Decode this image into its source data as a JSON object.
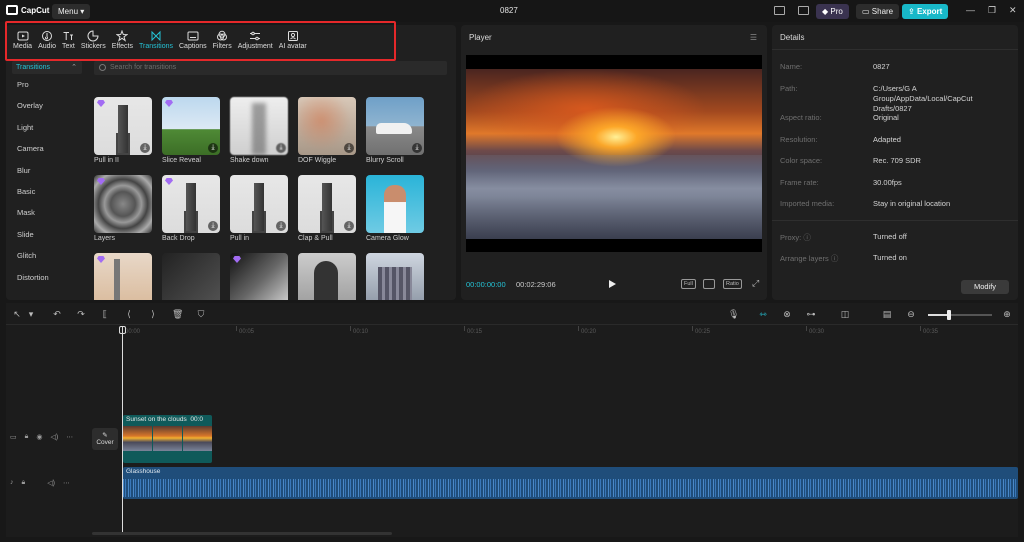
{
  "app": {
    "logo_text": "CapCut",
    "menu_label": "Menu",
    "project_title": "0827",
    "pro_label": "Pro",
    "share_label": "Share",
    "export_label": "Export"
  },
  "toolbar": {
    "items": [
      {
        "label": "Media",
        "icon": "media-icon"
      },
      {
        "label": "Audio",
        "icon": "audio-icon"
      },
      {
        "label": "Text",
        "icon": "text-icon"
      },
      {
        "label": "Stickers",
        "icon": "stickers-icon"
      },
      {
        "label": "Effects",
        "icon": "effects-icon"
      },
      {
        "label": "Transitions",
        "icon": "transitions-icon",
        "active": true
      },
      {
        "label": "Captions",
        "icon": "captions-icon"
      },
      {
        "label": "Filters",
        "icon": "filters-icon"
      },
      {
        "label": "Adjustment",
        "icon": "adjustment-icon"
      },
      {
        "label": "AI avatar",
        "icon": "ai-avatar-icon"
      }
    ],
    "accent_color": "#25c3d6",
    "highlight_color": "#e5282a"
  },
  "categories": {
    "header": "Transitions",
    "items": [
      "Pro",
      "Overlay",
      "Light",
      "Camera",
      "Blur",
      "Basic",
      "Mask",
      "Slide",
      "Glitch",
      "Distortion"
    ]
  },
  "search": {
    "placeholder": "Search for transitions"
  },
  "transitions": [
    {
      "label": "Pull in II"
    },
    {
      "label": "Slice Reveal"
    },
    {
      "label": "Shake down"
    },
    {
      "label": "DOF Wiggle"
    },
    {
      "label": "Blurry Scroll"
    },
    {
      "label": "Layers"
    },
    {
      "label": "Back Drop"
    },
    {
      "label": "Pull in"
    },
    {
      "label": "Clap & Pull"
    },
    {
      "label": "Camera Glow"
    },
    {
      "label": ""
    },
    {
      "label": ""
    },
    {
      "label": ""
    },
    {
      "label": ""
    },
    {
      "label": ""
    }
  ],
  "player": {
    "title": "Player",
    "current_time": "00:00:00:00",
    "total_time": "00:02:29:06",
    "full_label": "Full",
    "ratio_label": "Ratio"
  },
  "details": {
    "title": "Details",
    "rows": [
      {
        "label": "Name:",
        "value": "0827"
      },
      {
        "label": "Path:",
        "value": "C:/Users/G A Group/AppData/Local/CapCut Drafts/0827"
      },
      {
        "label": "Aspect ratio:",
        "value": "Original"
      },
      {
        "label": "Resolution:",
        "value": "Adapted"
      },
      {
        "label": "Color space:",
        "value": "Rec. 709 SDR"
      },
      {
        "label": "Frame rate:",
        "value": "30.00fps"
      },
      {
        "label": "Imported media:",
        "value": "Stay in original location"
      },
      {
        "label": "Proxy:",
        "value": "Turned off"
      },
      {
        "label": "Arrange layers",
        "value": "Turned on"
      }
    ],
    "modify_label": "Modify"
  },
  "timeline": {
    "ruler_ticks": [
      "00:00",
      "00:05",
      "00:10",
      "00:15",
      "00:20",
      "00:25",
      "00:30",
      "00:35"
    ],
    "cover_label": "Cover",
    "video_clip": {
      "title": "Sunset on the clouds",
      "duration": "00:0"
    },
    "audio_clip": {
      "title": "Glasshouse"
    }
  }
}
